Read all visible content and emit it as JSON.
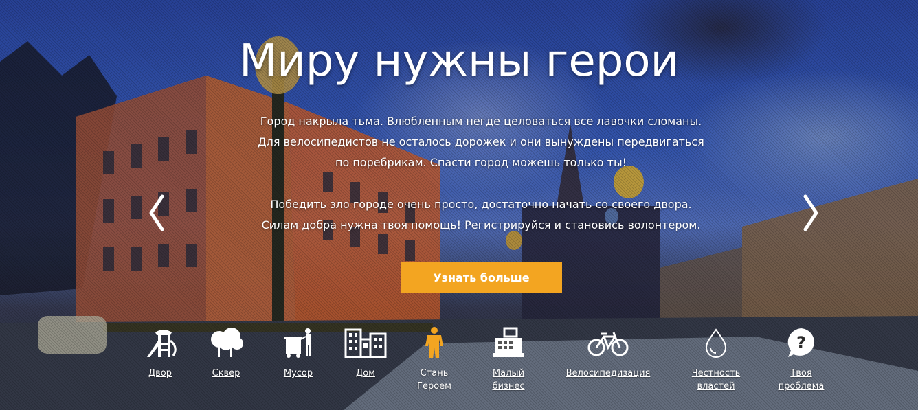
{
  "hero": {
    "title": "Миру нужны герои",
    "description_line1": "Город накрыла тьма. Влюбленным негде целоваться все лавочки сломаны.",
    "description_line2": "Для велосипедистов не осталось дорожек и они вынуждены передвигаться",
    "description_line3": "по поребрикам. Спасти город можешь только ты!",
    "description_line4": "Победить зло городе очень просто, достаточно начать со своего двора.",
    "description_line5": "Силам добра нужна твоя помощь! Регистрируйся и становись волонтером.",
    "cta_label": "Узнать больше",
    "arrows": {
      "prev": "prev-arrow-icon",
      "next": "next-arrow-icon"
    }
  },
  "categories": [
    {
      "label": "Двор",
      "icon": "playground-icon"
    },
    {
      "label": "Сквер",
      "icon": "trees-icon"
    },
    {
      "label": "Мусор",
      "icon": "garbage-icon"
    },
    {
      "label": "Дом",
      "icon": "house-icon"
    },
    {
      "label": "Стань\nГероем",
      "icon": "hero-person-icon"
    },
    {
      "label": "Малый\nбизнес",
      "icon": "cash-register-icon"
    },
    {
      "label": "Велосипедизация",
      "icon": "bicycle-icon"
    },
    {
      "label": "Честность\nвластей",
      "icon": "drop-icon"
    },
    {
      "label": "Твоя\nпроблема",
      "icon": "question-bubble-icon"
    }
  ],
  "colors": {
    "accent": "#f3a521",
    "text": "#ffffff"
  }
}
